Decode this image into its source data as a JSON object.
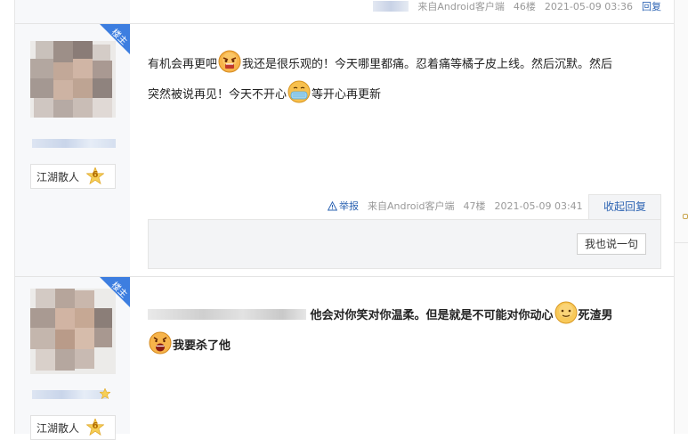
{
  "top_meta": {
    "source": "来自Android客户端",
    "floor": "46楼",
    "timestamp": "2021-05-09 03:36",
    "reply_link": "回复"
  },
  "posts": [
    {
      "badge": "楼主",
      "rank_label": "江湖散人",
      "level": "6",
      "text_1": "有机会再更吧",
      "text_2": "我还是很乐观的！今天哪里都痛。忍着痛等橘子皮上线。然后沉默。然后",
      "text_3": "突然被说再见！今天不开心",
      "text_4": "等开心再更新",
      "emoji_1": "angry-face-icon",
      "emoji_2": "sick-face-icon",
      "report": "举报",
      "source": "来自Android客户端",
      "floor": "47楼",
      "timestamp": "2021-05-09 03:41",
      "collapse_reply": "收起回复",
      "say_button": "我也说一句"
    },
    {
      "badge": "楼主",
      "rank_label": "江湖散人",
      "level": "6",
      "text_1": "他会对你笑对你温柔。但是就是不可能对你动心",
      "text_2": "死渣男",
      "text_3": "我要杀了他",
      "emoji_1": "smile-face-icon",
      "emoji_2": "shouting-face-icon"
    }
  ],
  "colors": {
    "link": "#2d64b3",
    "badge": "#3d7ee0",
    "meta": "#999999"
  }
}
